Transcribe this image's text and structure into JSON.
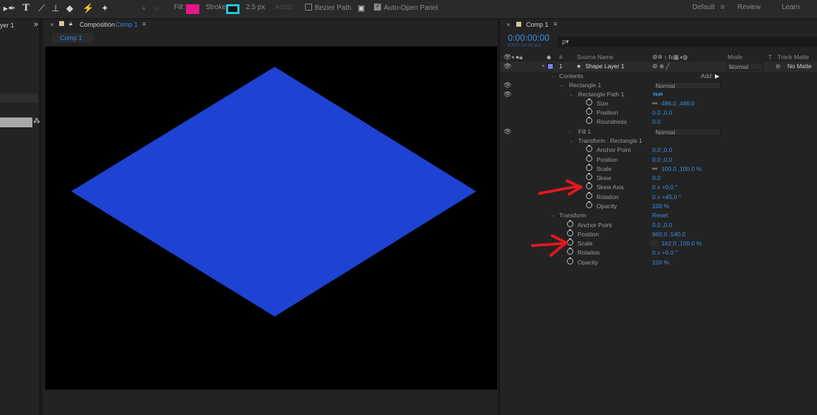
{
  "toolbar": {
    "fill_label": "Fill:",
    "fill_color": "#e01888",
    "stroke_label": "Stroke:",
    "stroke_color": "#26c6d9",
    "stroke_width": "2.5 px",
    "add_label": "Add:",
    "bezier_path": "Bezier Path",
    "auto_open_panel": "Auto-Open Panel",
    "workspaces": [
      "Default",
      "Review",
      "Learn"
    ]
  },
  "left_panel": {
    "title": "yer 1"
  },
  "viewer": {
    "panel_title": "Composition",
    "comp_name": "Comp 1",
    "breadcrumb": "Comp 1",
    "shape_color": "#1e42d2"
  },
  "timeline": {
    "tab": "Comp 1",
    "timecode": "0:00:00:00",
    "fps": "00000 (30.00 fps)",
    "search_placeholder": "ρ▾",
    "headers": {
      "source_name": "Source Name",
      "mode": "Mode",
      "t": "T",
      "track_matte": "Track Matte"
    },
    "layer": {
      "index": "1",
      "name": "Shape Layer 1",
      "mode": "Normal",
      "matte": "No Matte",
      "label_color": "#7d7de8"
    },
    "contents_label": "Contents",
    "add_label": "Add:",
    "rect1_label": "Rectangle 1",
    "rect1_mode": "Normal",
    "rectpath_label": "Rectangle Path 1",
    "size_label": "Size",
    "size_value": "486.0 ,486.0",
    "pos_label": "Position",
    "pos_value": "0.0 ,0.0",
    "round_label": "Roundness",
    "round_value": "0.0",
    "fill_label": "Fill 1",
    "fill_mode": "Normal",
    "tr_label": "Transform : Rectangle 1",
    "tr_anchor_label": "Anchor Point",
    "tr_anchor_value": "0.0 ,0.0",
    "tr_pos_label": "Position",
    "tr_pos_value": "0.0 ,0.0",
    "tr_scale_label": "Scale",
    "tr_scale_value": "100.0 ,100.0 %",
    "tr_skew_label": "Skew",
    "tr_skew_value": "0.0",
    "tr_skewaxis_label": "Skew Axis",
    "tr_skewaxis_value": "0 x +0.0 °",
    "tr_rot_label": "Rotation",
    "tr_rot_value": "0 x +45.0 °",
    "tr_opacity_label": "Opacity",
    "tr_opacity_value": "100 %",
    "transform_label": "Transform",
    "reset_label": "Reset",
    "lt_anchor_label": "Anchor Point",
    "lt_anchor_value": "0.0 ,0.0",
    "lt_pos_label": "Position",
    "lt_pos_value": "960.0 ,540.0",
    "lt_scale_label": "Scale",
    "lt_scale_value": "162.0 ,100.0 %",
    "lt_rot_label": "Rotation",
    "lt_rot_value": "0 x +0.0 °",
    "lt_opacity_label": "Opacity",
    "lt_opacity_value": "100 %"
  },
  "annotations": {
    "arrow_color": "#e0191b"
  }
}
